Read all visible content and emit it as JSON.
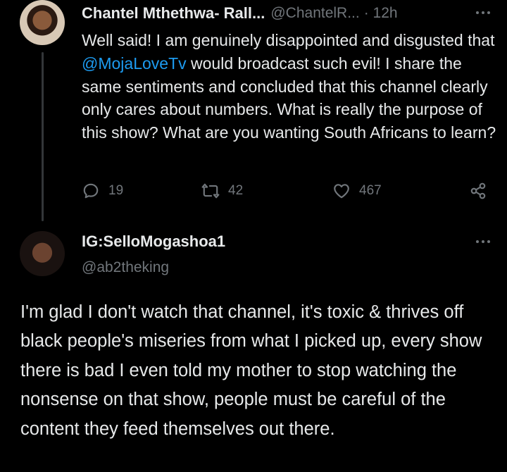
{
  "tweet1": {
    "display_name": "Chantel Mthethwa- Rall...",
    "handle": "@ChantelR...",
    "time": "· 12h",
    "text_before": "Well said! I am genuinely disappointed and disgusted that ",
    "mention": "@MojaLoveTv",
    "text_after": " would broadcast such evil! I share the same sentiments and concluded that this channel clearly only cares about numbers. What is really the purpose of this show? What are you wanting South Africans to learn?",
    "replies": "19",
    "retweets": "42",
    "likes": "467"
  },
  "tweet2": {
    "display_name": "IG:SelloMogashoa1",
    "handle": "@ab2theking",
    "text": "I'm glad I don't watch that channel, it's  toxic & thrives off black people's miseries from what I picked up, every show there is bad I even told my mother to stop watching  the nonsense on that show, people must be careful  of the content they feed themselves out there."
  },
  "icons": {
    "more": "more-icon",
    "reply": "reply-icon",
    "retweet": "retweet-icon",
    "like": "heart-icon",
    "share": "share-icon"
  },
  "colors": {
    "background": "#000000",
    "text": "#e7e9ea",
    "secondary": "#71767b",
    "link": "#1d9bf0"
  }
}
